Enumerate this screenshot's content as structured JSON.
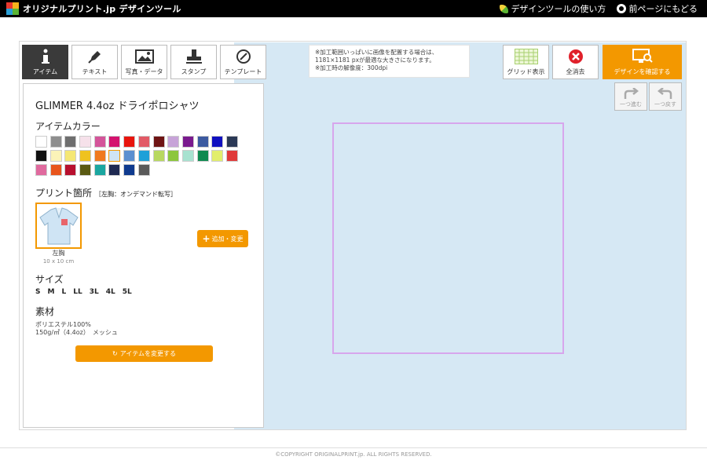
{
  "header": {
    "logo_text": "オリジナルプリント.jp デザインツール",
    "links": [
      {
        "label": "デザインツールの使い方",
        "icon": "leaf-icon"
      },
      {
        "label": "前ページにもどる",
        "icon": "back-icon"
      }
    ]
  },
  "toolbar": {
    "tabs": [
      {
        "label": "アイテム",
        "icon": "info-icon",
        "active": true
      },
      {
        "label": "テキスト",
        "icon": "pen-icon"
      },
      {
        "label": "写真・データ",
        "icon": "image-icon"
      },
      {
        "label": "スタンプ",
        "icon": "stamp-icon"
      },
      {
        "label": "テンプレート",
        "icon": "template-icon"
      }
    ]
  },
  "panel": {
    "item_name": "GLIMMER 4.4oz ドライポロシャツ",
    "color_section": "アイテムカラー",
    "colors": [
      "#ffffff",
      "#8e8e8e",
      "#6e6e6e",
      "#f6e1ea",
      "#d4559a",
      "#d4126e",
      "#e8150d",
      "#e25a66",
      "#6e1414",
      "#c7a3d8",
      "#7a1a8e",
      "#3c5aa0",
      "#1010c0",
      "#2b3956",
      "#111111",
      "#fbf3b8",
      "#f5e774",
      "#efc21f",
      "#f07a1e",
      "#cfe4f4",
      "#5b8fd0",
      "#1ea0d8",
      "#b8d860",
      "#8cc63c",
      "#a8e2d0",
      "#0f8a50",
      "#e2ee6c",
      "#e03a3a",
      "#e06a9e",
      "#e8551c",
      "#b8102e",
      "#5a5a12",
      "#1aa6a0",
      "#1f2a52",
      "#0f3a8e",
      "#5a5a5a"
    ],
    "print_section": "プリント箇所",
    "print_sub": "［左胸：オンデマンド転写］",
    "location_label": "左胸",
    "location_dim": "10 x 10 cm",
    "add_button": "追加・変更",
    "size_section": "サイズ",
    "sizes": [
      "S",
      "M",
      "L",
      "LL",
      "3L",
      "4L",
      "5L"
    ],
    "material_section": "素材",
    "material_line1": "ポリエステル100%",
    "material_line2": "150g/㎡（4.4oz）　メッシュ",
    "change_button": "アイテムを変更する"
  },
  "note": {
    "line1": "※加工範囲いっぱいに画像を配置する場合は、",
    "line2": "1181×1181 pxが最適な大きさになります。",
    "line3": "※加工時の解像度：300dpi"
  },
  "actions": {
    "grid": "グリッド表示",
    "clear": "全消去",
    "confirm": "デザインを確認する",
    "redo": "一つ進む",
    "undo": "一つ戻す"
  },
  "footer": "©COPYRIGHT ORIGINALPRINT.jp. ALL RIGHTS RESERVED."
}
